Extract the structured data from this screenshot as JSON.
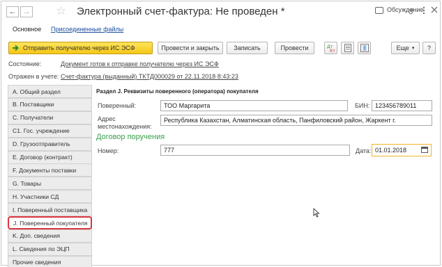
{
  "window": {
    "title": "Электронный счет-фактура: Не проведен *",
    "discussion_label": "Обсуждение",
    "link_icon": "link-icon",
    "menu_icon": "more-vertical-icon",
    "close_icon": "close-icon"
  },
  "tabs": {
    "main": "Основное",
    "attached": "Присоединенные файлы"
  },
  "toolbar": {
    "send_label": "Отправить получателю через ИС ЭСФ",
    "post_close_label": "Провести и закрыть",
    "save_label": "Записать",
    "post_label": "Провести",
    "more_label": "Еще",
    "help_label": "?"
  },
  "status": {
    "state_label": "Состояние:",
    "state_value": "Документ готов к отправке получателю через ИС ЭСФ",
    "reflected_label": "Отражен в учете:",
    "reflected_value": "Счет-фактура (выданный) ТКТД000029 от 22.11.2018 8:43:23"
  },
  "sections": [
    "А. Общий раздел",
    "В. Поставщики",
    "С. Получатели",
    "С1. Гос. учреждение",
    "D. Грузоотправитель",
    "Е. Договор (контракт)",
    "F. Документы поставки",
    "G. Товары",
    "Н. Участники СД",
    "I. Поверенный поставщика",
    "J. Поверенный покупателя",
    "K. Доп. сведения",
    "L. Сведения по ЭЦП",
    "Прочие сведения"
  ],
  "active_section_index": 10,
  "form": {
    "section_title": "Раздел J. Реквизиты поверенного (оператора) покупателя",
    "attorney_label": "Поверенный:",
    "attorney_value": "ТОО Маргарита",
    "bin_label": "БИН:",
    "bin_value": "123456789011",
    "address_label_1": "Адрес",
    "address_label_2": "местонахождения:",
    "address_value": "Республика Казахстан, Алматинская область, Панфиловский район, Жаркент г.",
    "contract_heading": "Договор поручения",
    "number_label": "Номер:",
    "number_value": "777",
    "date_label": "Дата:",
    "date_value": "01.01.2018",
    "calendar_icon": "calendar-icon"
  },
  "colors": {
    "accent_yellow": "#f4c718",
    "link_blue": "#1b4fa0",
    "heading_green": "#3aa04a",
    "highlight_red": "#d9363e",
    "focus_orange": "#f0b429"
  }
}
